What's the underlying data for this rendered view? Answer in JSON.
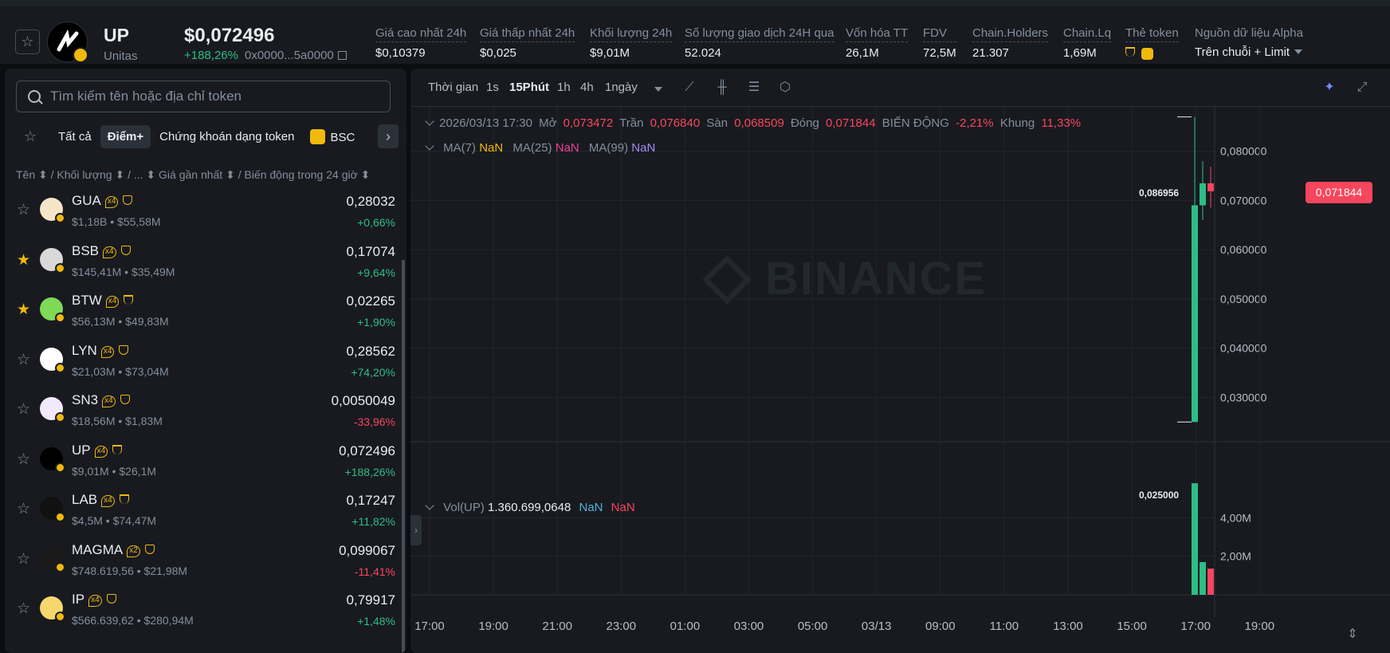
{
  "token": {
    "symbol": "UP",
    "name": "Unitas",
    "price": "$0,072496",
    "change": "+188,26%",
    "address": "0x0000...5a0000"
  },
  "stats": [
    {
      "label": "Giá cao nhất 24h",
      "value": "$0,10379"
    },
    {
      "label": "Giá thấp nhất 24h",
      "value": "$0,025"
    },
    {
      "label": "Khối lượng 24h",
      "value": "$9,01M"
    },
    {
      "label": "Số lượng giao dịch 24H qua",
      "value": "52.024"
    },
    {
      "label": "Vốn hóa TT",
      "value": "26,1M"
    },
    {
      "label": "FDV",
      "value": "72,5M"
    },
    {
      "label": "Chain.Holders",
      "value": "21.307"
    },
    {
      "label": "Chain.Lq",
      "value": "1,69M"
    },
    {
      "label": "Thẻ token",
      "value": ""
    },
    {
      "label": "Nguồn dữ liệu Alpha",
      "value": "Trên chuỗi + Limit"
    }
  ],
  "search": {
    "placeholder": "Tìm kiếm tên hoặc địa chỉ token"
  },
  "filters": [
    "Tất cả",
    "Điểm+",
    "Chứng khoán dạng token",
    "BSC"
  ],
  "columns": "Tên ⬍ / Khối lượng ⬍ / ...  ⬍ Giá gần nhất ⬍ / Biến động trong 24 giờ ⬍",
  "tokens": [
    {
      "sym": "GUA",
      "mult": "x4",
      "tag": "gem",
      "sub": "$1,18B • $55,58M",
      "price": "0,28032",
      "chg": "+0,66%",
      "dir": "pos",
      "fav": false,
      "color": "#f5e6c8"
    },
    {
      "sym": "BSB",
      "mult": "x4",
      "tag": "gem",
      "sub": "$145,41M • $35,49M",
      "price": "0,17074",
      "chg": "+9,64%",
      "dir": "pos",
      "fav": true,
      "color": "#d9d9d9"
    },
    {
      "sym": "BTW",
      "mult": "x4",
      "tag": "cup",
      "sub": "$56,13M • $49,83M",
      "price": "0,02265",
      "chg": "+1,90%",
      "dir": "pos",
      "fav": true,
      "color": "#7ed957"
    },
    {
      "sym": "LYN",
      "mult": "x4",
      "tag": "gem",
      "sub": "$21,03M • $73,04M",
      "price": "0,28562",
      "chg": "+74,20%",
      "dir": "pos",
      "fav": false,
      "color": "#ffffff"
    },
    {
      "sym": "SN3",
      "mult": "x4",
      "tag": "gem",
      "sub": "$18,56M • $1,83M",
      "price": "0,0050049",
      "chg": "-33,96%",
      "dir": "neg",
      "fav": false,
      "color": "#f3e9ff"
    },
    {
      "sym": "UP",
      "mult": "x4",
      "tag": "cup",
      "sub": "$9,01M • $26,1M",
      "price": "0,072496",
      "chg": "+188,26%",
      "dir": "pos",
      "fav": false,
      "color": "#000000"
    },
    {
      "sym": "LAB",
      "mult": "x4",
      "tag": "cup",
      "sub": "$4,5M • $74,47M",
      "price": "0,17247",
      "chg": "+11,82%",
      "dir": "pos",
      "fav": false,
      "color": "#111111"
    },
    {
      "sym": "MAGMA",
      "mult": "x2",
      "tag": "gem",
      "sub": "$748.619,56 • $21,98M",
      "price": "0,099067",
      "chg": "-11,41%",
      "dir": "neg",
      "fav": false,
      "color": "#1a1a1a"
    },
    {
      "sym": "IP",
      "mult": "x4",
      "tag": "gem",
      "sub": "$566.639,62 • $280,94M",
      "price": "0,79917",
      "chg": "+1,48%",
      "dir": "pos",
      "fav": false,
      "color": "#f5d76e"
    }
  ],
  "chart": {
    "timeLabel": "Thời gian",
    "intervals": [
      "1s",
      "15Phút",
      "1h",
      "4h",
      "1ngày"
    ],
    "activeInterval": "15Phút",
    "ohlc": {
      "date": "2026/03/13 17:30",
      "open_label": "Mở",
      "open": "0,073472",
      "high_label": "Trần",
      "high": "0,076840",
      "low_label": "Sàn",
      "low": "0,068509",
      "close_label": "Đóng",
      "close": "0,071844",
      "change_label": "BIẾN ĐỘNG",
      "change": "-2,21%",
      "range_label": "Khung",
      "range": "11,33%"
    },
    "ma": [
      {
        "label": "MA(7)",
        "value": "NaN",
        "color": "#f0b90b"
      },
      {
        "label": "MA(25)",
        "value": "NaN",
        "color": "#e84393"
      },
      {
        "label": "MA(99)",
        "value": "NaN",
        "color": "#a68bf0"
      }
    ],
    "vol": {
      "label": "Vol(UP)",
      "value": "1.360.699,0648",
      "v1": "NaN",
      "v2": "NaN"
    },
    "watermark": "BINANCE",
    "currentPrice": "0,071844",
    "highMark": "0,086956",
    "lowMark": "0,025000"
  },
  "chart_data": {
    "type": "candlestick",
    "x_ticks": [
      "17:00",
      "19:00",
      "21:00",
      "23:00",
      "01:00",
      "03:00",
      "05:00",
      "03/13",
      "09:00",
      "11:00",
      "13:00",
      "15:00",
      "17:00",
      "19:00"
    ],
    "y_ticks": [
      "0,080000",
      "0,070000",
      "0,060000",
      "0,050000",
      "0,040000",
      "0,030000"
    ],
    "ylim": [
      0.021,
      0.089
    ],
    "vol_ticks": [
      "4,00M",
      "2,00M"
    ],
    "vol_ylim": [
      0,
      6300000
    ],
    "candles": [
      {
        "t": "2026/03/13 17:00",
        "open": 0.025,
        "high": 0.086956,
        "low": 0.025,
        "close": 0.069,
        "vol": 5800000
      },
      {
        "t": "2026/03/13 17:15",
        "open": 0.069,
        "high": 0.078,
        "low": 0.066,
        "close": 0.073472,
        "vol": 1700000
      },
      {
        "t": "2026/03/13 17:30",
        "open": 0.073472,
        "high": 0.07684,
        "low": 0.068509,
        "close": 0.071844,
        "vol": 1360699
      }
    ]
  }
}
